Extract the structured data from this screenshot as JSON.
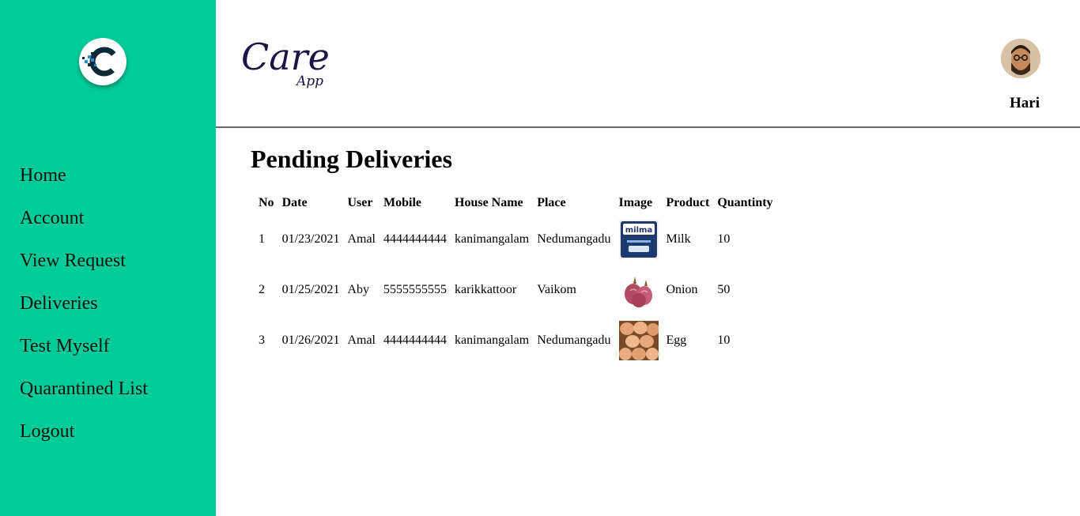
{
  "sidebar": {
    "logo_icon": "care-c-logo-icon",
    "accent_color": "#00cc99",
    "items": [
      {
        "label": "Home"
      },
      {
        "label": "Account"
      },
      {
        "label": "View Request"
      },
      {
        "label": "Deliveries"
      },
      {
        "label": "Test Myself"
      },
      {
        "label": "Quarantined List"
      },
      {
        "label": "Logout"
      }
    ]
  },
  "header": {
    "brand_main": "Care",
    "brand_sub": "App",
    "user_name": "Hari"
  },
  "main": {
    "title": "Pending Deliveries",
    "columns": [
      "No",
      "Date",
      "User",
      "Mobile",
      "House Name",
      "Place",
      "Image",
      "Product",
      "Quantinty"
    ],
    "rows": [
      {
        "no": "1",
        "date": "01/23/2021",
        "user": "Amal",
        "mobile": "4444444444",
        "house": "kanimangalam",
        "place": "Nedumangadu",
        "image": "milk-packet-image",
        "image_text": "milma",
        "product": "Milk",
        "qty": "10"
      },
      {
        "no": "2",
        "date": "01/25/2021",
        "user": "Aby",
        "mobile": "5555555555",
        "house": "karikkattoor",
        "place": "Vaikom",
        "image": "onion-image",
        "product": "Onion",
        "qty": "50"
      },
      {
        "no": "3",
        "date": "01/26/2021",
        "user": "Amal",
        "mobile": "4444444444",
        "house": "kanimangalam",
        "place": "Nedumangadu",
        "image": "eggs-image",
        "product": "Egg",
        "qty": "10"
      }
    ]
  }
}
